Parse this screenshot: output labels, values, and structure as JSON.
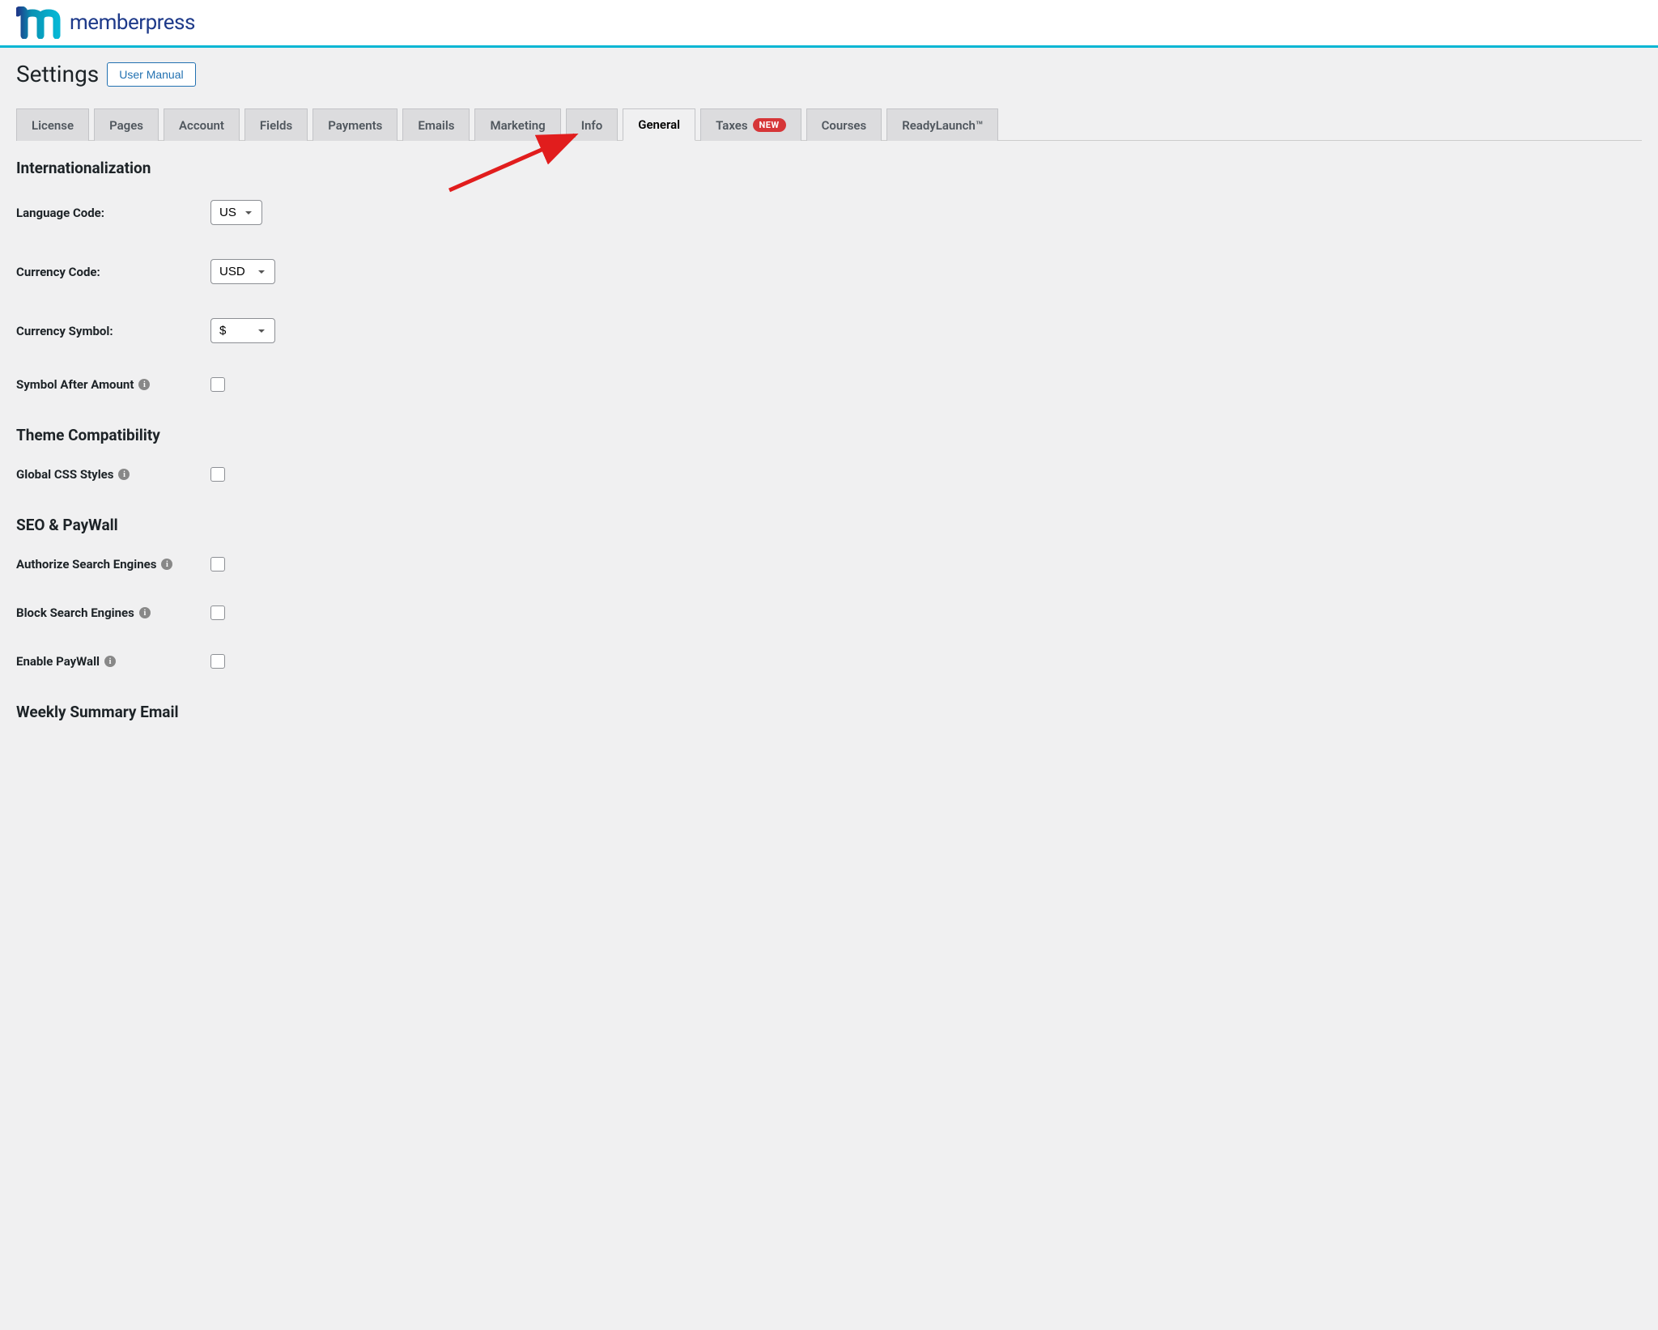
{
  "header": {
    "brand_text": "memberpress"
  },
  "page": {
    "title": "Settings",
    "user_manual_label": "User Manual"
  },
  "tabs": [
    {
      "label": "License",
      "active": false
    },
    {
      "label": "Pages",
      "active": false
    },
    {
      "label": "Account",
      "active": false
    },
    {
      "label": "Fields",
      "active": false
    },
    {
      "label": "Payments",
      "active": false
    },
    {
      "label": "Emails",
      "active": false
    },
    {
      "label": "Marketing",
      "active": false
    },
    {
      "label": "Info",
      "active": false
    },
    {
      "label": "General",
      "active": true
    },
    {
      "label": "Taxes",
      "active": false,
      "badge": "NEW"
    },
    {
      "label": "Courses",
      "active": false
    },
    {
      "label": "ReadyLaunch™",
      "active": false
    }
  ],
  "sections": {
    "internationalization": {
      "heading": "Internationalization",
      "language_code": {
        "label": "Language Code:",
        "value": "US"
      },
      "currency_code": {
        "label": "Currency Code:",
        "value": "USD"
      },
      "currency_symbol": {
        "label": "Currency Symbol:",
        "value": "$"
      },
      "symbol_after_amount": {
        "label": "Symbol After Amount"
      }
    },
    "theme_compatibility": {
      "heading": "Theme Compatibility",
      "global_css": {
        "label": "Global CSS Styles"
      }
    },
    "seo_paywall": {
      "heading": "SEO & PayWall",
      "authorize_search": {
        "label": "Authorize Search Engines"
      },
      "block_search": {
        "label": "Block Search Engines"
      },
      "enable_paywall": {
        "label": "Enable PayWall"
      }
    },
    "weekly_summary": {
      "heading": "Weekly Summary Email"
    }
  }
}
